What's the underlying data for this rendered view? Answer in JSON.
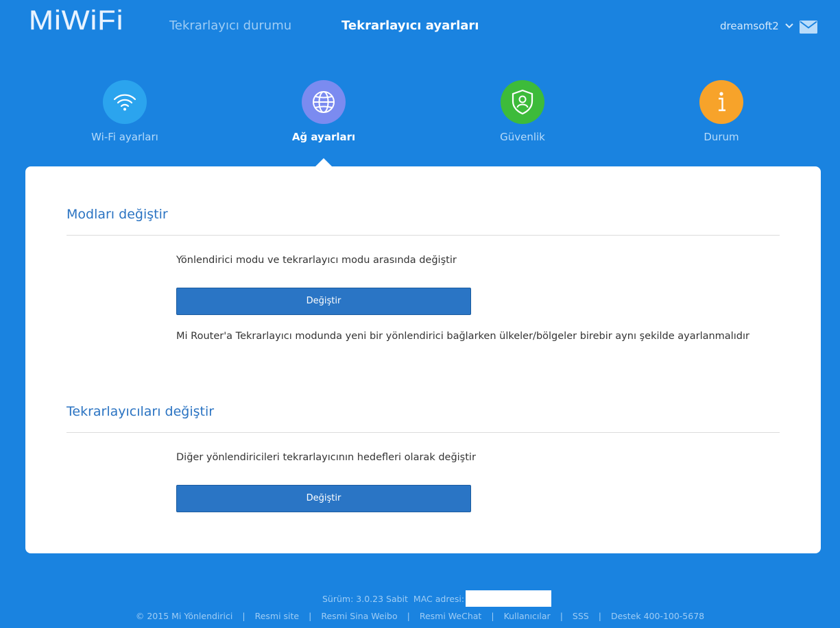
{
  "header": {
    "logo": "MiWiFi",
    "nav": {
      "status": "Tekrarlayıcı durumu",
      "settings": "Tekrarlayıcı ayarları"
    },
    "user": "dreamsoft2",
    "icons": {
      "user_chevron": "chevron-down-icon",
      "mail": "mail-icon"
    }
  },
  "categories": [
    {
      "label": "Wi-Fi ayarları",
      "icon": "wifi-icon",
      "color": "#2ba4ee",
      "active": false
    },
    {
      "label": "Ağ ayarları",
      "icon": "globe-icon",
      "color": "#7b8bf0",
      "active": true
    },
    {
      "label": "Güvenlik",
      "icon": "shield-user-icon",
      "color": "#3dbb3a",
      "active": false
    },
    {
      "label": "Durum",
      "icon": "info-icon",
      "color": "#f7a32a",
      "active": false
    }
  ],
  "sections": [
    {
      "title": "Modları değiştir",
      "description": "Yönlendirici modu ve tekrarlayıcı modu arasında değiştir",
      "button": "Değiştir",
      "note": "Mi Router'a Tekrarlayıcı modunda yeni bir yönlendirici bağlarken ülkeler/bölgeler birebir aynı şekilde ayarlanmalıdır"
    },
    {
      "title": "Tekrarlayıcıları değiştir",
      "description": "Diğer yönlendiricileri tekrarlayıcının hedefleri olarak değiştir",
      "button": "Değiştir"
    }
  ],
  "footer": {
    "version": "Sürüm: 3.0.23 Sabit",
    "mac_label": "MAC adresi:",
    "links": [
      "© 2015 Mi Yönlendirici",
      "Resmi site",
      "Resmi Sina Weibo",
      "Resmi WeChat",
      "Kullanıcılar",
      "SSS",
      "Destek 400-100-5678"
    ]
  },
  "colors": {
    "background": "#1a83e0",
    "accent": "#2a73c2",
    "button": "#2a75c5"
  }
}
